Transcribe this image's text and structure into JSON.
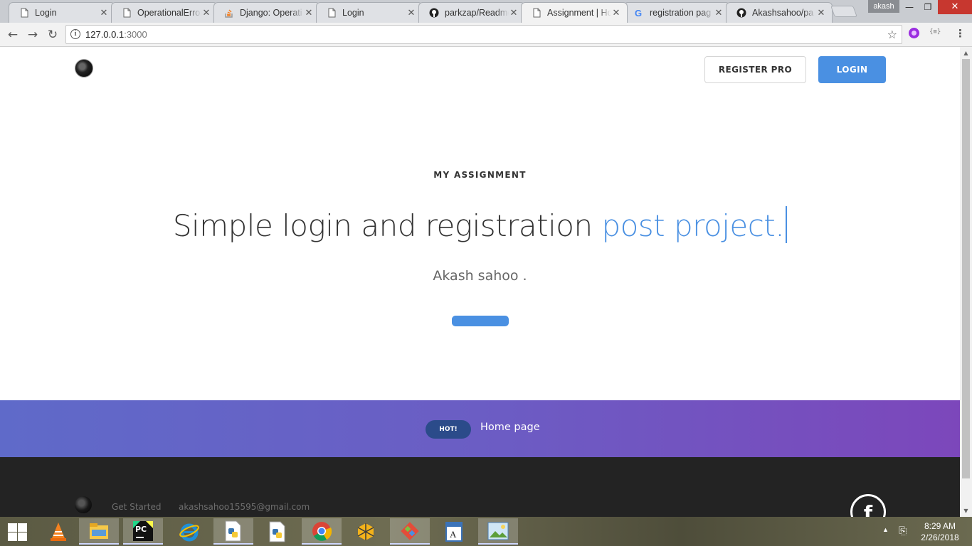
{
  "browser": {
    "tabs": [
      {
        "title": "Login",
        "icon": "page-icon",
        "active": false
      },
      {
        "title": "OperationalError",
        "icon": "page-icon",
        "active": false
      },
      {
        "title": "Django: Operati",
        "icon": "stackoverflow-icon",
        "active": false
      },
      {
        "title": "Login",
        "icon": "page-icon",
        "active": false
      },
      {
        "title": "parkzap/Readme",
        "icon": "github-icon",
        "active": false
      },
      {
        "title": "Assignment | Ho",
        "icon": "page-icon",
        "active": true
      },
      {
        "title": "registration pag",
        "icon": "google-icon",
        "active": false
      },
      {
        "title": "Akashsahoo/pa",
        "icon": "github-icon",
        "active": false
      }
    ],
    "profile_name": "akash",
    "address": {
      "host": "127.0.0.1",
      "port": ":3000"
    }
  },
  "page": {
    "nav": {
      "register_label": "REGISTER PRO",
      "login_label": "LOGIN"
    },
    "hero": {
      "eyebrow": "MY ASSIGNMENT",
      "headline_main": "Simple login and registration ",
      "headline_accent": "post project.",
      "author": "Akash sahoo ."
    },
    "banner": {
      "badge": "HOT!",
      "link": "Home page"
    },
    "footer": {
      "links": [
        "Get Started",
        "akashsahoo15595@gmail.com"
      ],
      "social": "f"
    }
  },
  "taskbar": {
    "apps": [
      {
        "name": "vlc-icon",
        "active": false
      },
      {
        "name": "file-explorer-icon",
        "active": true
      },
      {
        "name": "pycharm-icon",
        "active": true
      },
      {
        "name": "internet-explorer-icon",
        "active": false
      },
      {
        "name": "python-file-icon",
        "active": true
      },
      {
        "name": "python-file-icon",
        "active": false
      },
      {
        "name": "chrome-icon",
        "active": true
      },
      {
        "name": "virtualbox-icon",
        "active": false
      },
      {
        "name": "git-icon",
        "active": true
      },
      {
        "name": "wordpad-icon",
        "active": false
      },
      {
        "name": "photos-icon",
        "active": true
      }
    ],
    "pycharm_label": "PC",
    "time": "8:29 AM",
    "date": "2/26/2018"
  },
  "colors": {
    "accent": "#4a90e2",
    "banner_start": "#5f6ac9",
    "banner_end": "#7c47bb",
    "footer": "#232323"
  }
}
